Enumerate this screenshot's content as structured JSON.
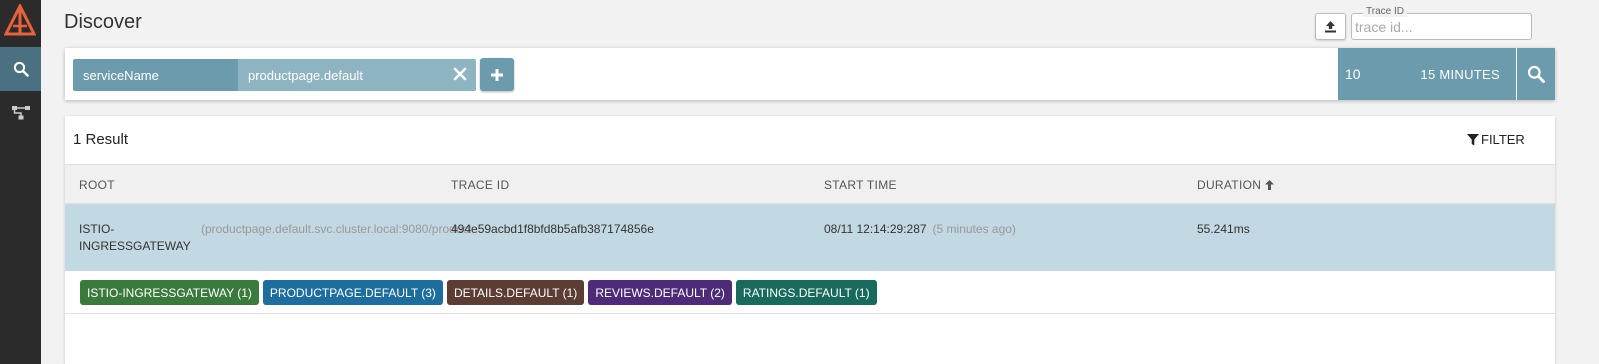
{
  "page": {
    "title": "Discover"
  },
  "sidebar": {
    "items": [
      {
        "name": "search",
        "icon": "search-icon"
      },
      {
        "name": "dependencies",
        "icon": "dependencies-icon"
      }
    ]
  },
  "header": {
    "upload_icon": "upload-icon",
    "trace_id": {
      "legend": "Trace ID",
      "placeholder": "trace id...",
      "value": ""
    }
  },
  "search": {
    "tags": [
      {
        "key": "serviceName",
        "value": "productpage.default"
      }
    ],
    "limit": "10",
    "lookback": "15 MINUTES"
  },
  "results": {
    "count_label": "1 Result",
    "filter_label": "FILTER",
    "columns": {
      "root": "ROOT",
      "trace_id": "TRACE ID",
      "start_time": "START TIME",
      "duration": "DURATION"
    },
    "rows": [
      {
        "root_service": "ISTIO-INGRESSGATEWAY",
        "root_operation": "(productpage.default.svc.cluster.local:9080/productpage)",
        "trace_id": "494e59acbd1f8bfd8b5afb387174856e",
        "start_time": "08/11 12:14:29:287",
        "start_relative": "(5 minutes ago)",
        "duration": "55.241ms",
        "service_tags": [
          {
            "label": "ISTIO-INGRESSGATEWAY (1)",
            "color": "#3a7a3c"
          },
          {
            "label": "PRODUCTPAGE.DEFAULT (3)",
            "color": "#1d6d9e"
          },
          {
            "label": "DETAILS.DEFAULT (1)",
            "color": "#5b3d33"
          },
          {
            "label": "REVIEWS.DEFAULT (2)",
            "color": "#4e2b78"
          },
          {
            "label": "RATINGS.DEFAULT (1)",
            "color": "#176a5c"
          }
        ]
      }
    ]
  },
  "colors": {
    "accent": "#6c9bad",
    "accent_light": "#8eb3c1",
    "row_highlight": "#c2d8e3",
    "sidebar": "#2b2b2b",
    "logo": "#e8623b"
  }
}
